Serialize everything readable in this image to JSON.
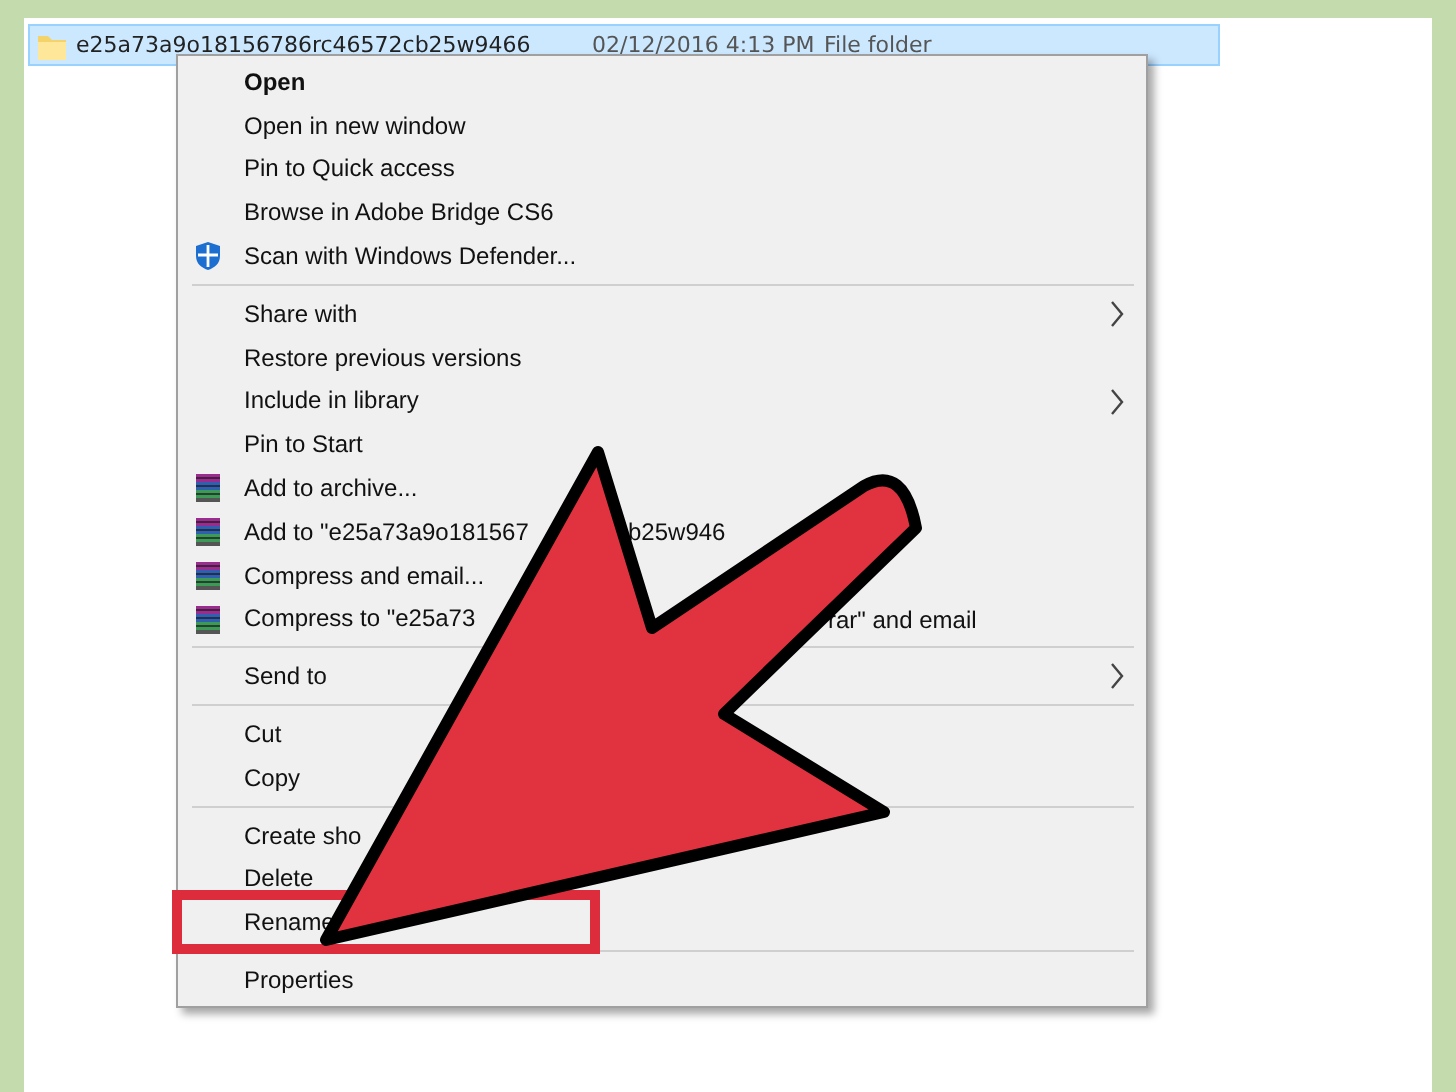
{
  "file_row": {
    "name": "e25a73a9o18156786rc46572cb25w9466",
    "date": "02/12/2016 4:13 PM",
    "type": "File folder",
    "selected": true
  },
  "context_menu": [
    {
      "kind": "item",
      "label": "Open",
      "default": true
    },
    {
      "kind": "item",
      "label": "Open in new window"
    },
    {
      "kind": "item",
      "label": "Pin to Quick access"
    },
    {
      "kind": "item",
      "label": "Browse in Adobe Bridge CS6"
    },
    {
      "kind": "scan",
      "label": "Scan with Windows Defender..."
    },
    {
      "kind": "separator"
    },
    {
      "kind": "item",
      "label": "Share with",
      "submenu": true
    },
    {
      "kind": "item",
      "label": "Restore previous versions"
    },
    {
      "kind": "item",
      "label": "Include in library",
      "submenu": true
    },
    {
      "kind": "item",
      "label": "Pin to Start"
    },
    {
      "kind": "archive",
      "label": "Add to archive..."
    },
    {
      "kind": "archive",
      "label": "Add to \"e25a73a9o181567",
      "tail": "b25w946"
    },
    {
      "kind": "archive",
      "label": "Compress and email..."
    },
    {
      "kind": "archive",
      "label": "Compress to \"e25a73",
      "tail": "rar\" and email"
    },
    {
      "kind": "separator"
    },
    {
      "kind": "item",
      "label": "Send to",
      "submenu": true
    },
    {
      "kind": "separator"
    },
    {
      "kind": "item",
      "label": "Cut"
    },
    {
      "kind": "item",
      "label": "Copy"
    },
    {
      "kind": "separator"
    },
    {
      "kind": "item",
      "label": "Create sho"
    },
    {
      "kind": "item",
      "label": "Delete"
    },
    {
      "kind": "item",
      "label": "Rename",
      "highlighted": true
    },
    {
      "kind": "separator"
    },
    {
      "kind": "item",
      "label": "Properties"
    }
  ],
  "annotation": {
    "kind": "arrow"
  }
}
